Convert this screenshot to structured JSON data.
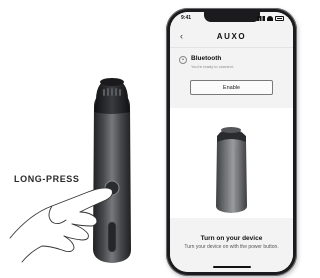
{
  "instruction": {
    "label": "LONG-PRESS"
  },
  "phone": {
    "status": {
      "time": "9:41"
    },
    "header": {
      "back_icon": "chevron-left-icon",
      "logo": "AUXO"
    },
    "bluetooth": {
      "step_icon": "step-circle-icon",
      "title": "Bluetooth",
      "subtitle": "You're ready to connect.",
      "enable_label": "Enable"
    },
    "turn_on": {
      "title": "Turn on your device",
      "subtitle": "Turn your device on with the power button."
    }
  },
  "colors": {
    "device_body": "#3a3b3d",
    "panel_bg": "#f3f3f3",
    "phone_frame": "#1b1b1d"
  }
}
